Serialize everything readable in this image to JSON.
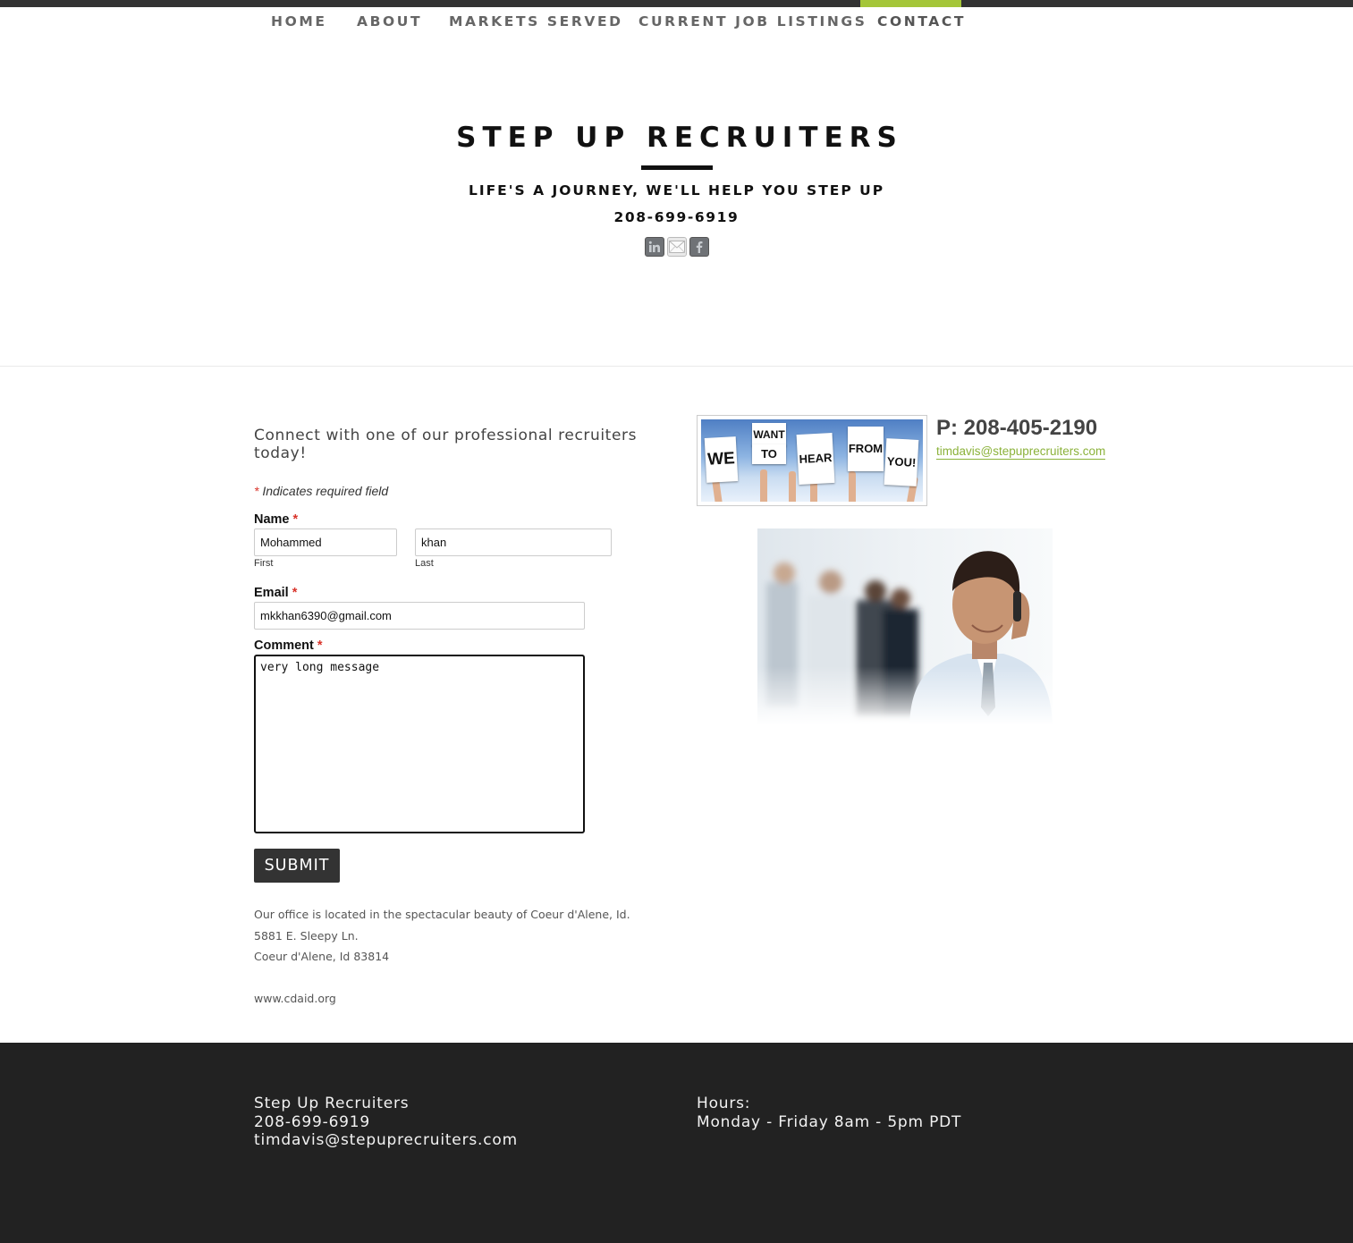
{
  "nav": {
    "items": [
      {
        "label": "HOME"
      },
      {
        "label": "ABOUT"
      },
      {
        "label": "MARKETS SERVED"
      },
      {
        "label": "CURRENT JOB LISTINGS"
      },
      {
        "label": "CONTACT"
      }
    ],
    "active": "CONTACT",
    "accent_color": "#a4c639"
  },
  "header": {
    "title": "STEP UP RECRUITERS",
    "tagline": "LIFE'S A JOURNEY, WE'LL HELP YOU STEP UP",
    "phone": "208-699-6919",
    "social_icons": [
      "linkedin-icon",
      "email-icon",
      "facebook-icon"
    ]
  },
  "form": {
    "intro": "Connect with one of our professional recruiters today!",
    "required_note": "Indicates required field",
    "required_marker": "*",
    "name_label": "Name",
    "first_value": "Mohammed",
    "first_sublabel": "First",
    "last_value": "khan",
    "last_sublabel": "Last",
    "email_label": "Email",
    "email_value": "mkkhan6390@gmail.com",
    "comment_label": "Comment",
    "comment_value": "very long message",
    "submit_label": "SUBMIT"
  },
  "address": {
    "line1": "Our office is located in the spectacular beauty of Coeur d'Alene, Id.",
    "line2": "5881 E. Sleepy Ln.",
    "line3": "Coeur d'Alene, Id 83814",
    "website": "www.cdaid.org"
  },
  "banner": {
    "words": [
      "WE",
      "WANT",
      "TO",
      "HEAR",
      "FROM",
      "YOU!"
    ]
  },
  "contact": {
    "phone": "P: 208-405-2190",
    "email": "timdavis@stepuprecruiters.com"
  },
  "footer": {
    "company": "Step Up Recruiters",
    "phone": "208-699-6919",
    "email": "timdavis@stepuprecruiters.com",
    "hours_label": "Hours:",
    "hours": "Monday - Friday 8am - 5pm PDT"
  }
}
